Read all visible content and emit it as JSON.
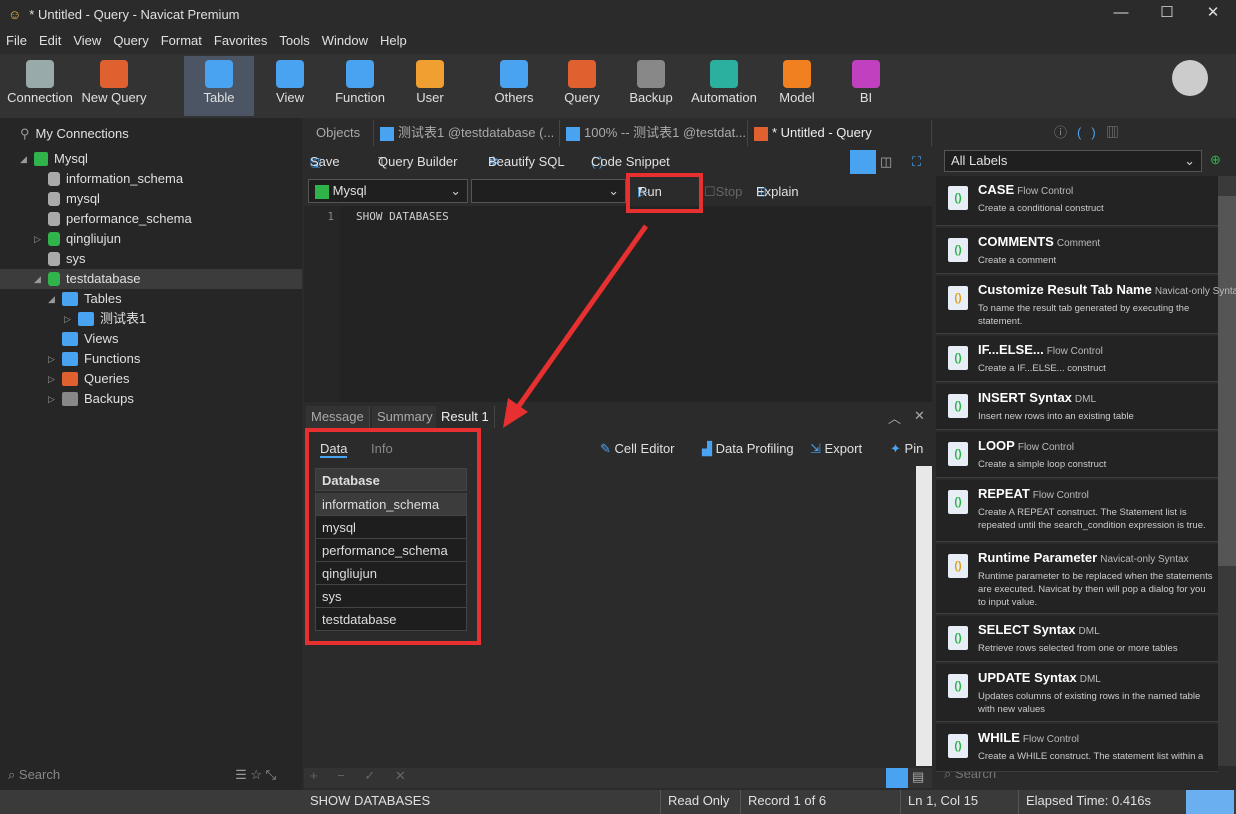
{
  "window": {
    "title": "* Untitled - Query - Navicat Premium"
  },
  "menu": [
    "File",
    "Edit",
    "View",
    "Query",
    "Format",
    "Favorites",
    "Tools",
    "Window",
    "Help"
  ],
  "toolbar": [
    {
      "label": "Connection",
      "icon": "connection-icon",
      "color": "#9aa"
    },
    {
      "label": "New Query",
      "icon": "new-query-icon",
      "color": "#e06030"
    },
    {
      "label": "Table",
      "icon": "table-icon",
      "color": "#4aa3f0",
      "selected": true
    },
    {
      "label": "View",
      "icon": "view-icon",
      "color": "#4aa3f0"
    },
    {
      "label": "Function",
      "icon": "function-icon",
      "color": "#4aa3f0"
    },
    {
      "label": "User",
      "icon": "user-icon",
      "color": "#f0a030"
    },
    {
      "label": "Others",
      "icon": "others-icon",
      "color": "#4aa3f0"
    },
    {
      "label": "Query",
      "icon": "query-icon",
      "color": "#e06030"
    },
    {
      "label": "Backup",
      "icon": "backup-icon",
      "color": "#888"
    },
    {
      "label": "Automation",
      "icon": "automation-icon",
      "color": "#2bb0a0"
    },
    {
      "label": "Model",
      "icon": "model-icon",
      "color": "#f08020"
    },
    {
      "label": "BI",
      "icon": "bi-icon",
      "color": "#c040c0"
    }
  ],
  "sidebar": {
    "root": "My Connections",
    "connection": "Mysql",
    "databases": [
      "information_schema",
      "mysql",
      "performance_schema",
      "qingliujun",
      "sys",
      "testdatabase"
    ],
    "selected": "testdatabase",
    "children": [
      "Tables",
      "测试表1",
      "Views",
      "Functions",
      "Queries",
      "Backups"
    ],
    "search_placeholder": "Search"
  },
  "tabs": [
    "Objects",
    "测试表1 @testdatabase (...",
    "100% -- 测试表1 @testdat...",
    "* Untitled - Query"
  ],
  "query_toolbar": {
    "save": "Save",
    "query_builder": "Query Builder",
    "beautify": "Beautify SQL",
    "snippet": "Code Snippet",
    "connection": "Mysql",
    "database": "",
    "run": "Run",
    "stop": "Stop",
    "explain": "Explain"
  },
  "editor": {
    "line": "1",
    "code": "SHOW DATABASES"
  },
  "result_tabs": [
    "Message",
    "Summary",
    "Result 1"
  ],
  "result_subtabs": [
    "Data",
    "Info"
  ],
  "result_actions": {
    "cell_editor": "Cell Editor",
    "data_profiling": "Data Profiling",
    "export": "Export",
    "pin": "Pin"
  },
  "grid": {
    "header": "Database",
    "rows": [
      "information_schema",
      "mysql",
      "performance_schema",
      "qingliujun",
      "sys",
      "testdatabase"
    ]
  },
  "right": {
    "labels_select": "All Labels",
    "search_placeholder": "Search",
    "snippets": [
      {
        "name": "CASE",
        "tag": "Flow Control",
        "desc": "Create a conditional construct"
      },
      {
        "name": "COMMENTS",
        "tag": "Comment",
        "desc": "Create a comment"
      },
      {
        "name": "Customize Result Tab Name",
        "tag": "Navicat-only Syntax",
        "desc": "To name the result tab generated by executing the statement."
      },
      {
        "name": "IF...ELSE...",
        "tag": "Flow Control",
        "desc": "Create a IF...ELSE... construct"
      },
      {
        "name": "INSERT Syntax",
        "tag": "DML",
        "desc": "Insert new rows into an existing table"
      },
      {
        "name": "LOOP",
        "tag": "Flow Control",
        "desc": "Create a simple loop construct"
      },
      {
        "name": "REPEAT",
        "tag": "Flow Control",
        "desc": "Create A REPEAT construct. The Statement list is repeated until the search_condition expression is true."
      },
      {
        "name": "Runtime Parameter",
        "tag": "Navicat-only Syntax",
        "desc": "Runtime parameter to be replaced when the statements are executed. Navicat by then will pop a dialog for you to input value."
      },
      {
        "name": "SELECT Syntax",
        "tag": "DML",
        "desc": "Retrieve rows selected from one or more tables"
      },
      {
        "name": "UPDATE Syntax",
        "tag": "DML",
        "desc": "Updates columns of existing rows in the named table with new values"
      },
      {
        "name": "WHILE",
        "tag": "Flow Control",
        "desc": "Create a WHILE construct. The statement list within a"
      }
    ]
  },
  "status": {
    "sql": "SHOW DATABASES",
    "mode": "Read Only",
    "record": "Record 1 of 6",
    "position": "Ln 1, Col 15",
    "elapsed": "Elapsed Time: 0.416s"
  },
  "colors": {
    "highlight": "#e83030",
    "accent": "#4aa3f0"
  }
}
